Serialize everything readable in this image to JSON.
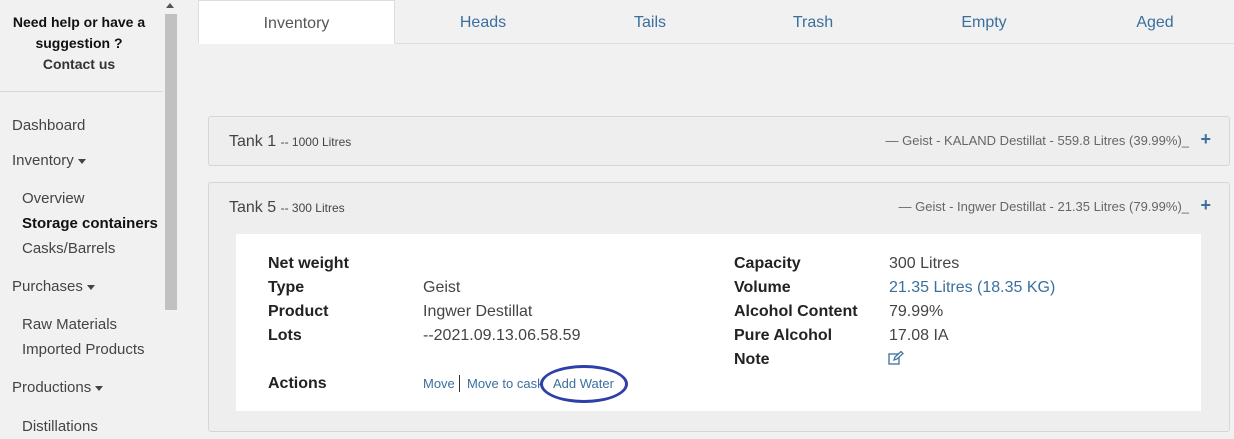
{
  "sidebar": {
    "help_line1": "Need help or have a",
    "help_line2": "suggestion ?",
    "contact": "Contact us",
    "dashboard": "Dashboard",
    "inventory": "Inventory",
    "overview": "Overview",
    "storage_containers": "Storage containers",
    "casks_barrels": "Casks/Barrels",
    "purchases": "Purchases",
    "raw_materials": "Raw Materials",
    "imported_products": "Imported Products",
    "productions": "Productions",
    "distillations": "Distillations"
  },
  "tabs": {
    "inventory": "Inventory",
    "heads": "Heads",
    "tails": "Tails",
    "trash": "Trash",
    "empty": "Empty",
    "aged": "Aged"
  },
  "tank1": {
    "name": "Tank 1",
    "capacity": "-- 1000 Litres",
    "summary": "— Geist - KALAND Destillat - 559.8 Litres (39.99%)_",
    "expand": "+"
  },
  "tank5": {
    "name": "Tank 5",
    "capacity": "-- 300 Litres",
    "summary": "— Geist - Ingwer Destillat - 21.35 Litres (79.99%)_",
    "expand": "+",
    "details": {
      "net_weight_label": "Net weight",
      "type_label": "Type",
      "type_value": "Geist",
      "product_label": "Product",
      "product_value": "Ingwer Destillat",
      "lots_label": "Lots",
      "lots_value": "--2021.09.13.06.58.59",
      "actions_label": "Actions",
      "action_move": "Move",
      "action_move_to_cask": "Move to cask",
      "action_add_water": "Add Water",
      "capacity_label": "Capacity",
      "capacity_value": "300 Litres",
      "volume_label": "Volume",
      "volume_value": "21.35 Litres (18.35 KG)",
      "alcohol_label": "Alcohol Content",
      "alcohol_value": "79.99%",
      "pure_alcohol_label": "Pure Alcohol",
      "pure_alcohol_value": "17.08 IA",
      "note_label": "Note",
      "note_icon": "edit-icon"
    }
  }
}
